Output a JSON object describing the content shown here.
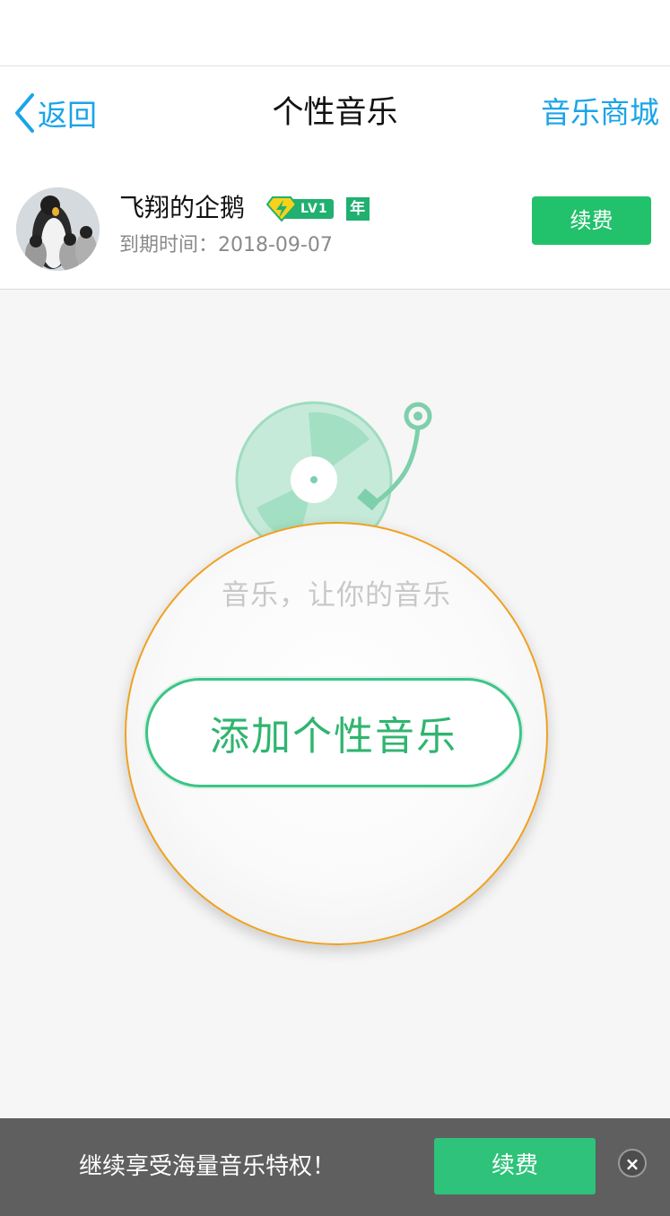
{
  "nav": {
    "back_label": "返回",
    "title": "个性音乐",
    "store_label": "音乐商城"
  },
  "profile": {
    "username": "飞翔的企鹅",
    "level_badge": "LV1",
    "year_badge": "年",
    "expire_text": "到期时间：2018-09-07",
    "renew_label": "续费"
  },
  "empty_state": {
    "description": "音乐，让你的音乐",
    "add_button_label": "添加个性音乐"
  },
  "bottom_banner": {
    "text": "继续享受海量音乐特权！",
    "renew_label": "续费",
    "close_icon": "close-icon"
  },
  "colors": {
    "accent_blue": "#1aa4e8",
    "accent_green": "#22c16b",
    "lens_border": "#f0a020"
  }
}
